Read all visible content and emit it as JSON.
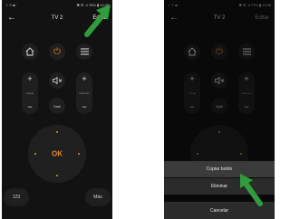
{
  "left_screen": {
    "status_left": "✓ ≡ ▰ ·",
    "status_right": "✱ ☰ .ıl 78% ▮ 11:28",
    "app_bar": {
      "title": "TV 2",
      "edit_label": "Editar"
    },
    "buttons": {
      "channel_label": "Canal",
      "volume_label": "Volumen",
      "exit_label": "Salir",
      "ok_label": "OK",
      "numbers_label": "123",
      "more_label": "Más"
    }
  },
  "right_screen": {
    "status_left": "✓ ≡ ▰ ·",
    "status_right": "✱ ☰ .ıl 77% ▮ 11:28",
    "app_bar": {
      "title": "TV 2",
      "edit_label": "Editar"
    },
    "buttons": {
      "channel_label": "Canal",
      "volume_label": "Volumen",
      "exit_label": "Salir"
    },
    "sheet": {
      "copy_label": "Copiar botón",
      "delete_label": "Eliminar",
      "cancel_label": "Cancelar"
    }
  },
  "colors": {
    "accent": "#e88b1c",
    "arrow": "#2e9e3a",
    "screen_bg": "#121212"
  },
  "icons": [
    "back-arrow-icon",
    "home-icon",
    "power-icon",
    "menu-icon",
    "mute-icon",
    "plus-icon",
    "minus-icon",
    "pointer-arrow-icon"
  ]
}
